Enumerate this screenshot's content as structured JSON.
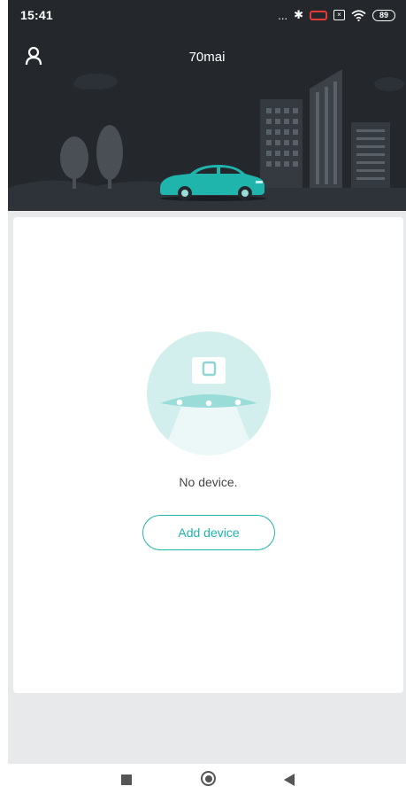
{
  "status_bar": {
    "time": "15:41",
    "dots": "...",
    "bluetooth_glyph": "✱",
    "battery_level": "89",
    "icons": [
      "bluetooth-icon",
      "battery-saver-icon",
      "sim-x-icon",
      "wifi-icon",
      "battery-icon"
    ]
  },
  "header": {
    "title": "70mai",
    "user_icon": "person-icon"
  },
  "empty_state": {
    "message": "No device.",
    "add_button_label": "Add device"
  },
  "navigation": {
    "icons": [
      "recents-square-icon",
      "home-circle-icon",
      "back-triangle-icon"
    ]
  },
  "colors": {
    "accent": "#1fb5ad",
    "header_bg": "#24282d",
    "content_bg": "#e8e9eb",
    "battery_warning": "#e53935"
  }
}
